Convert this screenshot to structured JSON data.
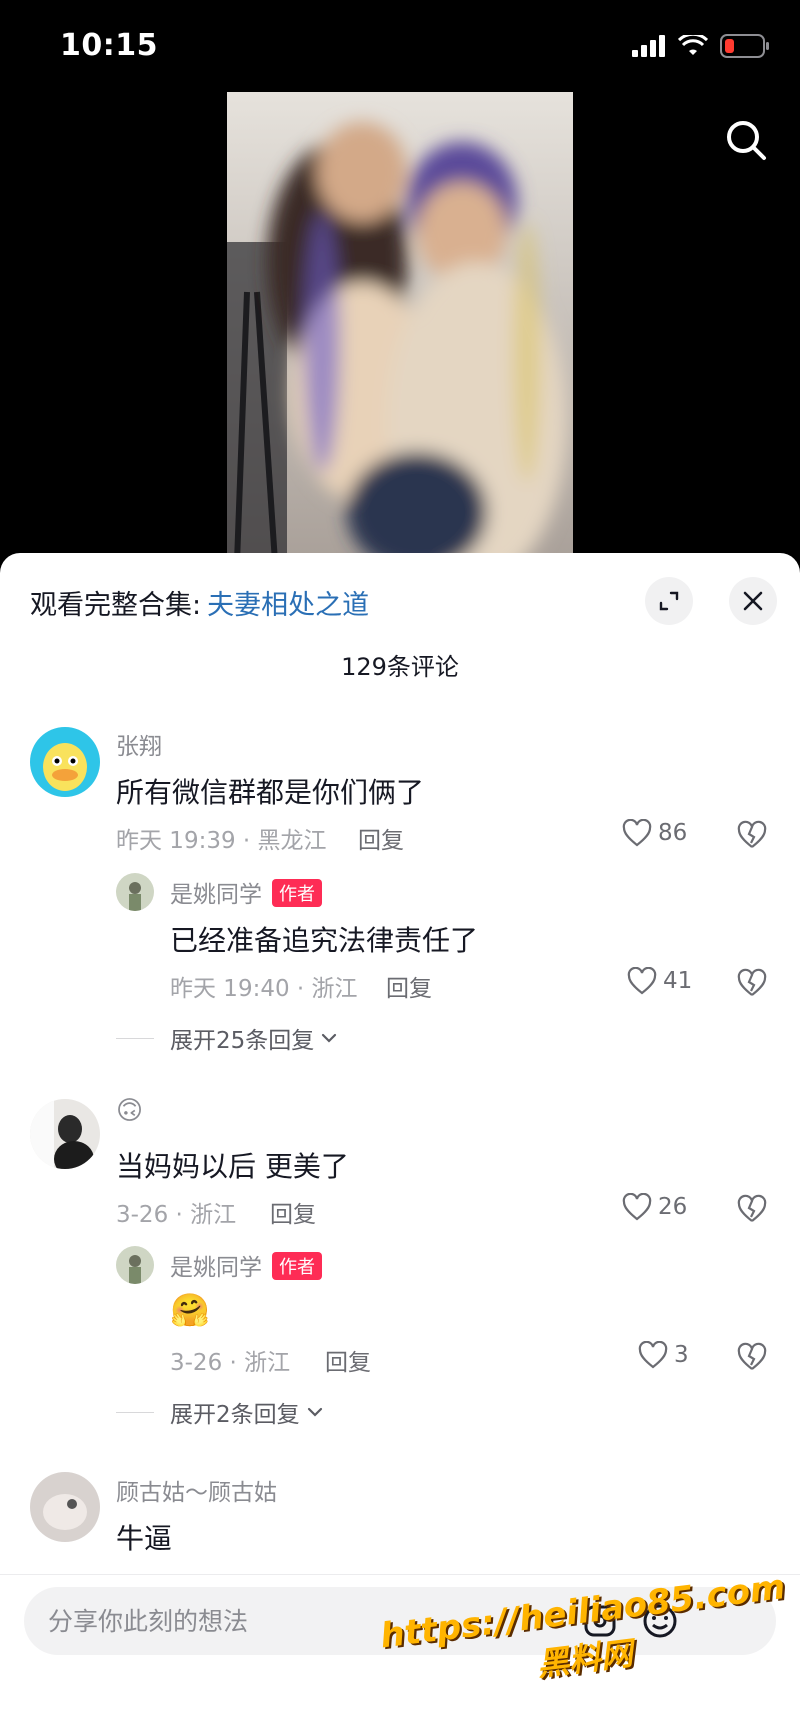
{
  "status": {
    "time": "10:15"
  },
  "header": {
    "collection_prefix": "观看完整合集:",
    "collection_name": "夫妻相处之道",
    "comment_count": "129条评论"
  },
  "comments": [
    {
      "user": "张翔",
      "text": "所有微信群都是你们俩了",
      "meta": "昨天 19:39 · 黑龙江",
      "reply_label": "回复",
      "likes": "86",
      "replies": [
        {
          "user": "是姚同学",
          "badge": "作者",
          "text": "已经准备追究法律责任了",
          "meta": "昨天 19:40 · 浙江",
          "reply_label": "回复",
          "likes": "41"
        }
      ],
      "expand_label": "展开25条回复"
    },
    {
      "user": "🙃",
      "text": "当妈妈以后 更美了",
      "meta": "3-26 · 浙江",
      "reply_label": "回复",
      "likes": "26",
      "replies": [
        {
          "user": "是姚同学",
          "badge": "作者",
          "text": "🤗",
          "meta": "3-26 · 浙江",
          "reply_label": "回复",
          "likes": "3"
        }
      ],
      "expand_label": "展开2条回复"
    },
    {
      "user": "顾古姑～顾古姑",
      "text": "牛逼"
    }
  ],
  "input": {
    "placeholder": "分享你此刻的想法"
  },
  "watermark": {
    "line1": "https://heiliao85.com",
    "line2": "黑料网"
  },
  "colors": {
    "accent_link": "#2a6fb5",
    "author_badge": "#fe2c55"
  },
  "icons": [
    "search-icon",
    "expand-icon",
    "close-icon",
    "heart-icon",
    "broken-heart-icon",
    "at-icon",
    "emoji-icon"
  ]
}
